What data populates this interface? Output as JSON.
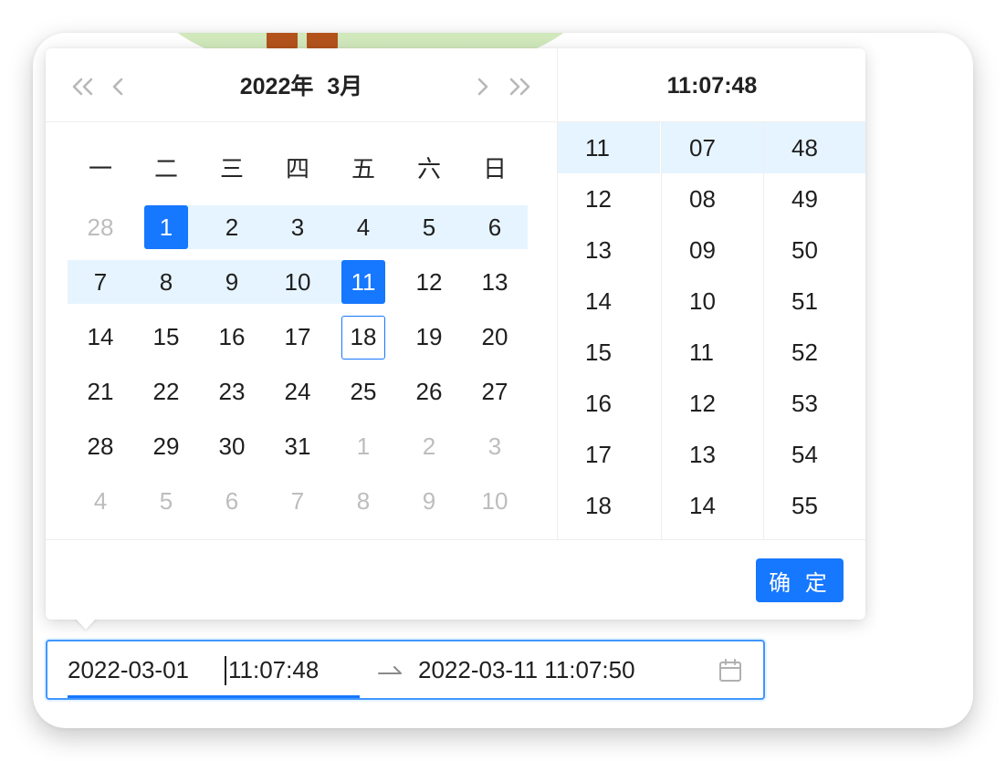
{
  "header": {
    "year_label": "2022年",
    "month_label": "3月",
    "time_title": "11:07:48"
  },
  "icons": {
    "super_prev": "double-chevron-left-icon",
    "prev": "chevron-left-icon",
    "next": "chevron-right-icon",
    "super_next": "double-chevron-right-icon",
    "calendar": "calendar-icon",
    "separator": "swap-arrow-icon"
  },
  "weekdays": [
    "一",
    "二",
    "三",
    "四",
    "五",
    "六",
    "日"
  ],
  "days": [
    [
      "28",
      "1",
      "2",
      "3",
      "4",
      "5",
      "6"
    ],
    [
      "7",
      "8",
      "9",
      "10",
      "11",
      "12",
      "13"
    ],
    [
      "14",
      "15",
      "16",
      "17",
      "18",
      "19",
      "20"
    ],
    [
      "21",
      "22",
      "23",
      "24",
      "25",
      "26",
      "27"
    ],
    [
      "28",
      "29",
      "30",
      "31",
      "1",
      "2",
      "3"
    ],
    [
      "4",
      "5",
      "6",
      "7",
      "8",
      "9",
      "10"
    ]
  ],
  "time": {
    "hours": [
      "11",
      "12",
      "13",
      "14",
      "15",
      "16",
      "17",
      "18"
    ],
    "minutes": [
      "07",
      "08",
      "09",
      "10",
      "11",
      "12",
      "13",
      "14"
    ],
    "seconds": [
      "48",
      "49",
      "50",
      "51",
      "52",
      "53",
      "54",
      "55"
    ]
  },
  "footer": {
    "ok_label": "确 定"
  },
  "input": {
    "start_date": "2022-03-01",
    "start_time": "11:07:48",
    "end_value": "2022-03-11 11:07:50"
  },
  "colors": {
    "primary": "#1677ff",
    "range_bg": "#e6f4ff",
    "muted_text": "#bdbdbd"
  }
}
